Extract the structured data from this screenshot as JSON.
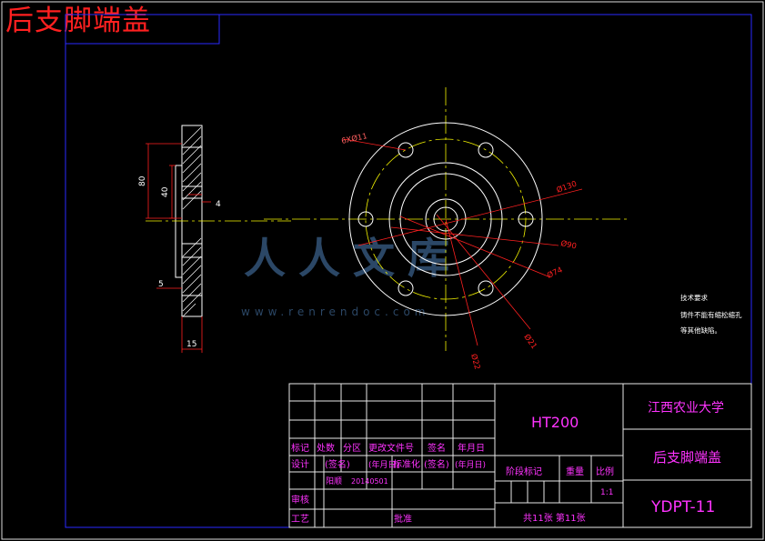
{
  "overlay_title": "后支脚端盖",
  "watermark": {
    "text_big": "人人文库",
    "url": "www.renrendoc.com",
    "color": "#3a5f88"
  },
  "colors": {
    "frame": "#2a2aff",
    "title_block": "#e8e8e8",
    "title_text_magenta": "#ff33ff",
    "geometry": "#ffffff",
    "center_line": "#f5f500",
    "dimension": "#ff2020"
  },
  "side_view": {
    "dims": {
      "d80": "80",
      "d40": "40",
      "d4": "4",
      "d5": "5",
      "d15": "15"
    }
  },
  "front_view": {
    "dims": {
      "holes": "6XØ11",
      "d130": "Ø130",
      "d90": "Ø90",
      "d74": "Ø74",
      "d21": "Ø21",
      "d22": "Ø22"
    }
  },
  "tech_req": {
    "title": "技术要求",
    "line1": "铸件不能有缩松缩孔",
    "line2": "等其他缺陷。"
  },
  "title_block": {
    "material": "HT200",
    "university": "江西农业大学",
    "part_name": "后支脚端盖",
    "drawing_no": "YDPT-11",
    "row_headers": [
      "标记",
      "处数",
      "分区",
      "更改文件号",
      "签名",
      "年月日"
    ],
    "design_label": "设计",
    "sig_name": "(签名)",
    "date_ymd": "(年月日)",
    "std_label": "标准化",
    "sig_name2": "(签名)",
    "date_ymd2": "(年月日)",
    "designer": "阳顺",
    "date_value": "20140501",
    "stage_mark": "阶段标记",
    "weight": "重量",
    "scale_label": "比例",
    "scale_value": "1:1",
    "review": "审核",
    "process": "工艺",
    "approve": "批准",
    "sheets": "共11张 第11张"
  }
}
